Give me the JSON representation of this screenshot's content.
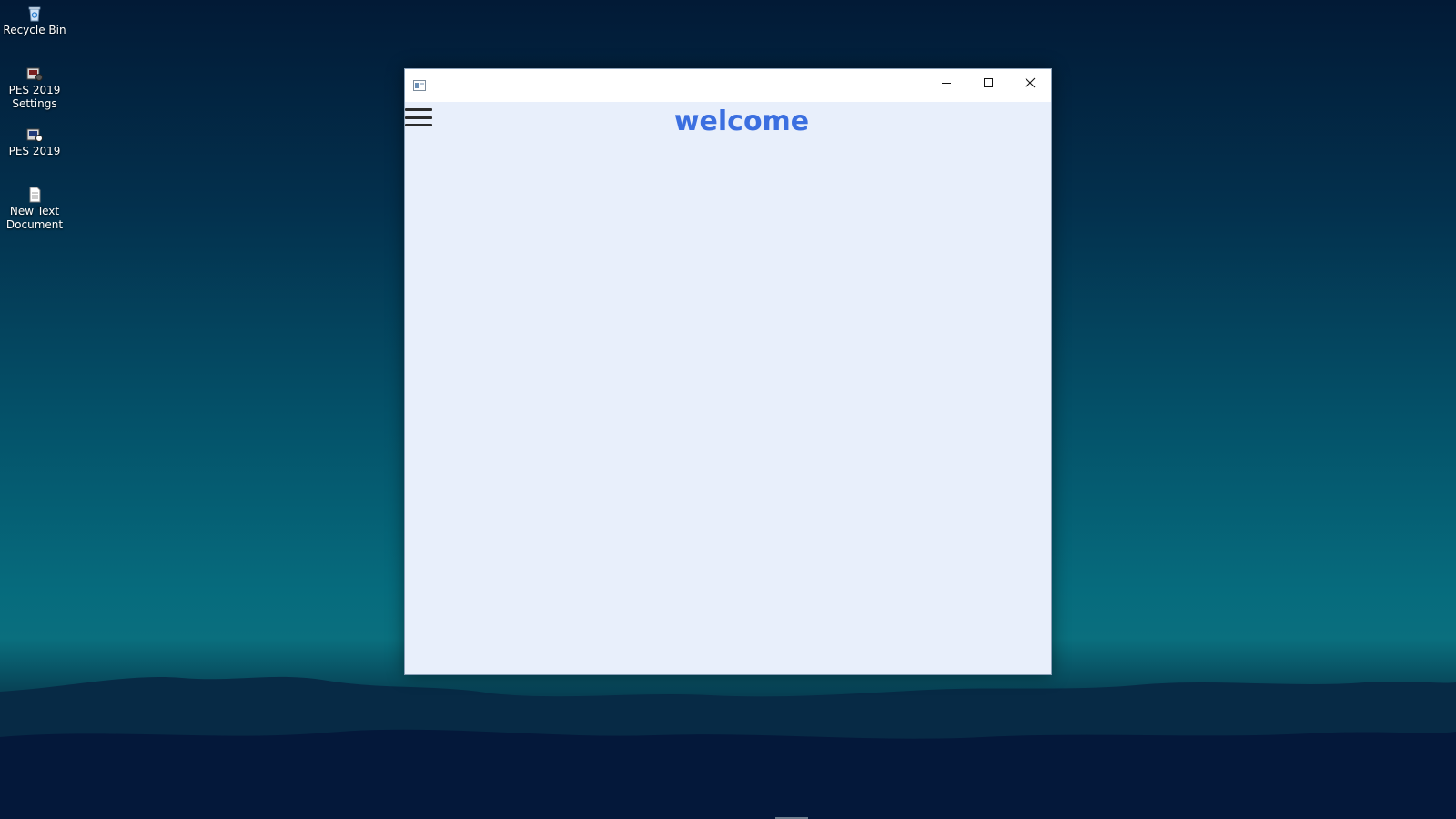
{
  "desktop": {
    "icons": [
      {
        "label": "Recycle Bin",
        "icon": "recycle-bin-icon"
      },
      {
        "label": "PES 2019 Settings",
        "icon": "pes-settings-icon"
      },
      {
        "label": "PES 2019",
        "icon": "pes-game-icon"
      },
      {
        "label": "New Text Document",
        "icon": "text-document-icon"
      }
    ]
  },
  "window": {
    "icon": "app-window-icon",
    "controls": {
      "minimize": "minimize-icon",
      "maximize": "maximize-icon",
      "close": "close-icon"
    },
    "content": {
      "menu_icon": "hamburger-menu-icon",
      "heading": "welcome"
    }
  },
  "colors": {
    "heading": "#3b6fe0",
    "window_background": "#e8effb",
    "titlebar_background": "#ffffff"
  }
}
